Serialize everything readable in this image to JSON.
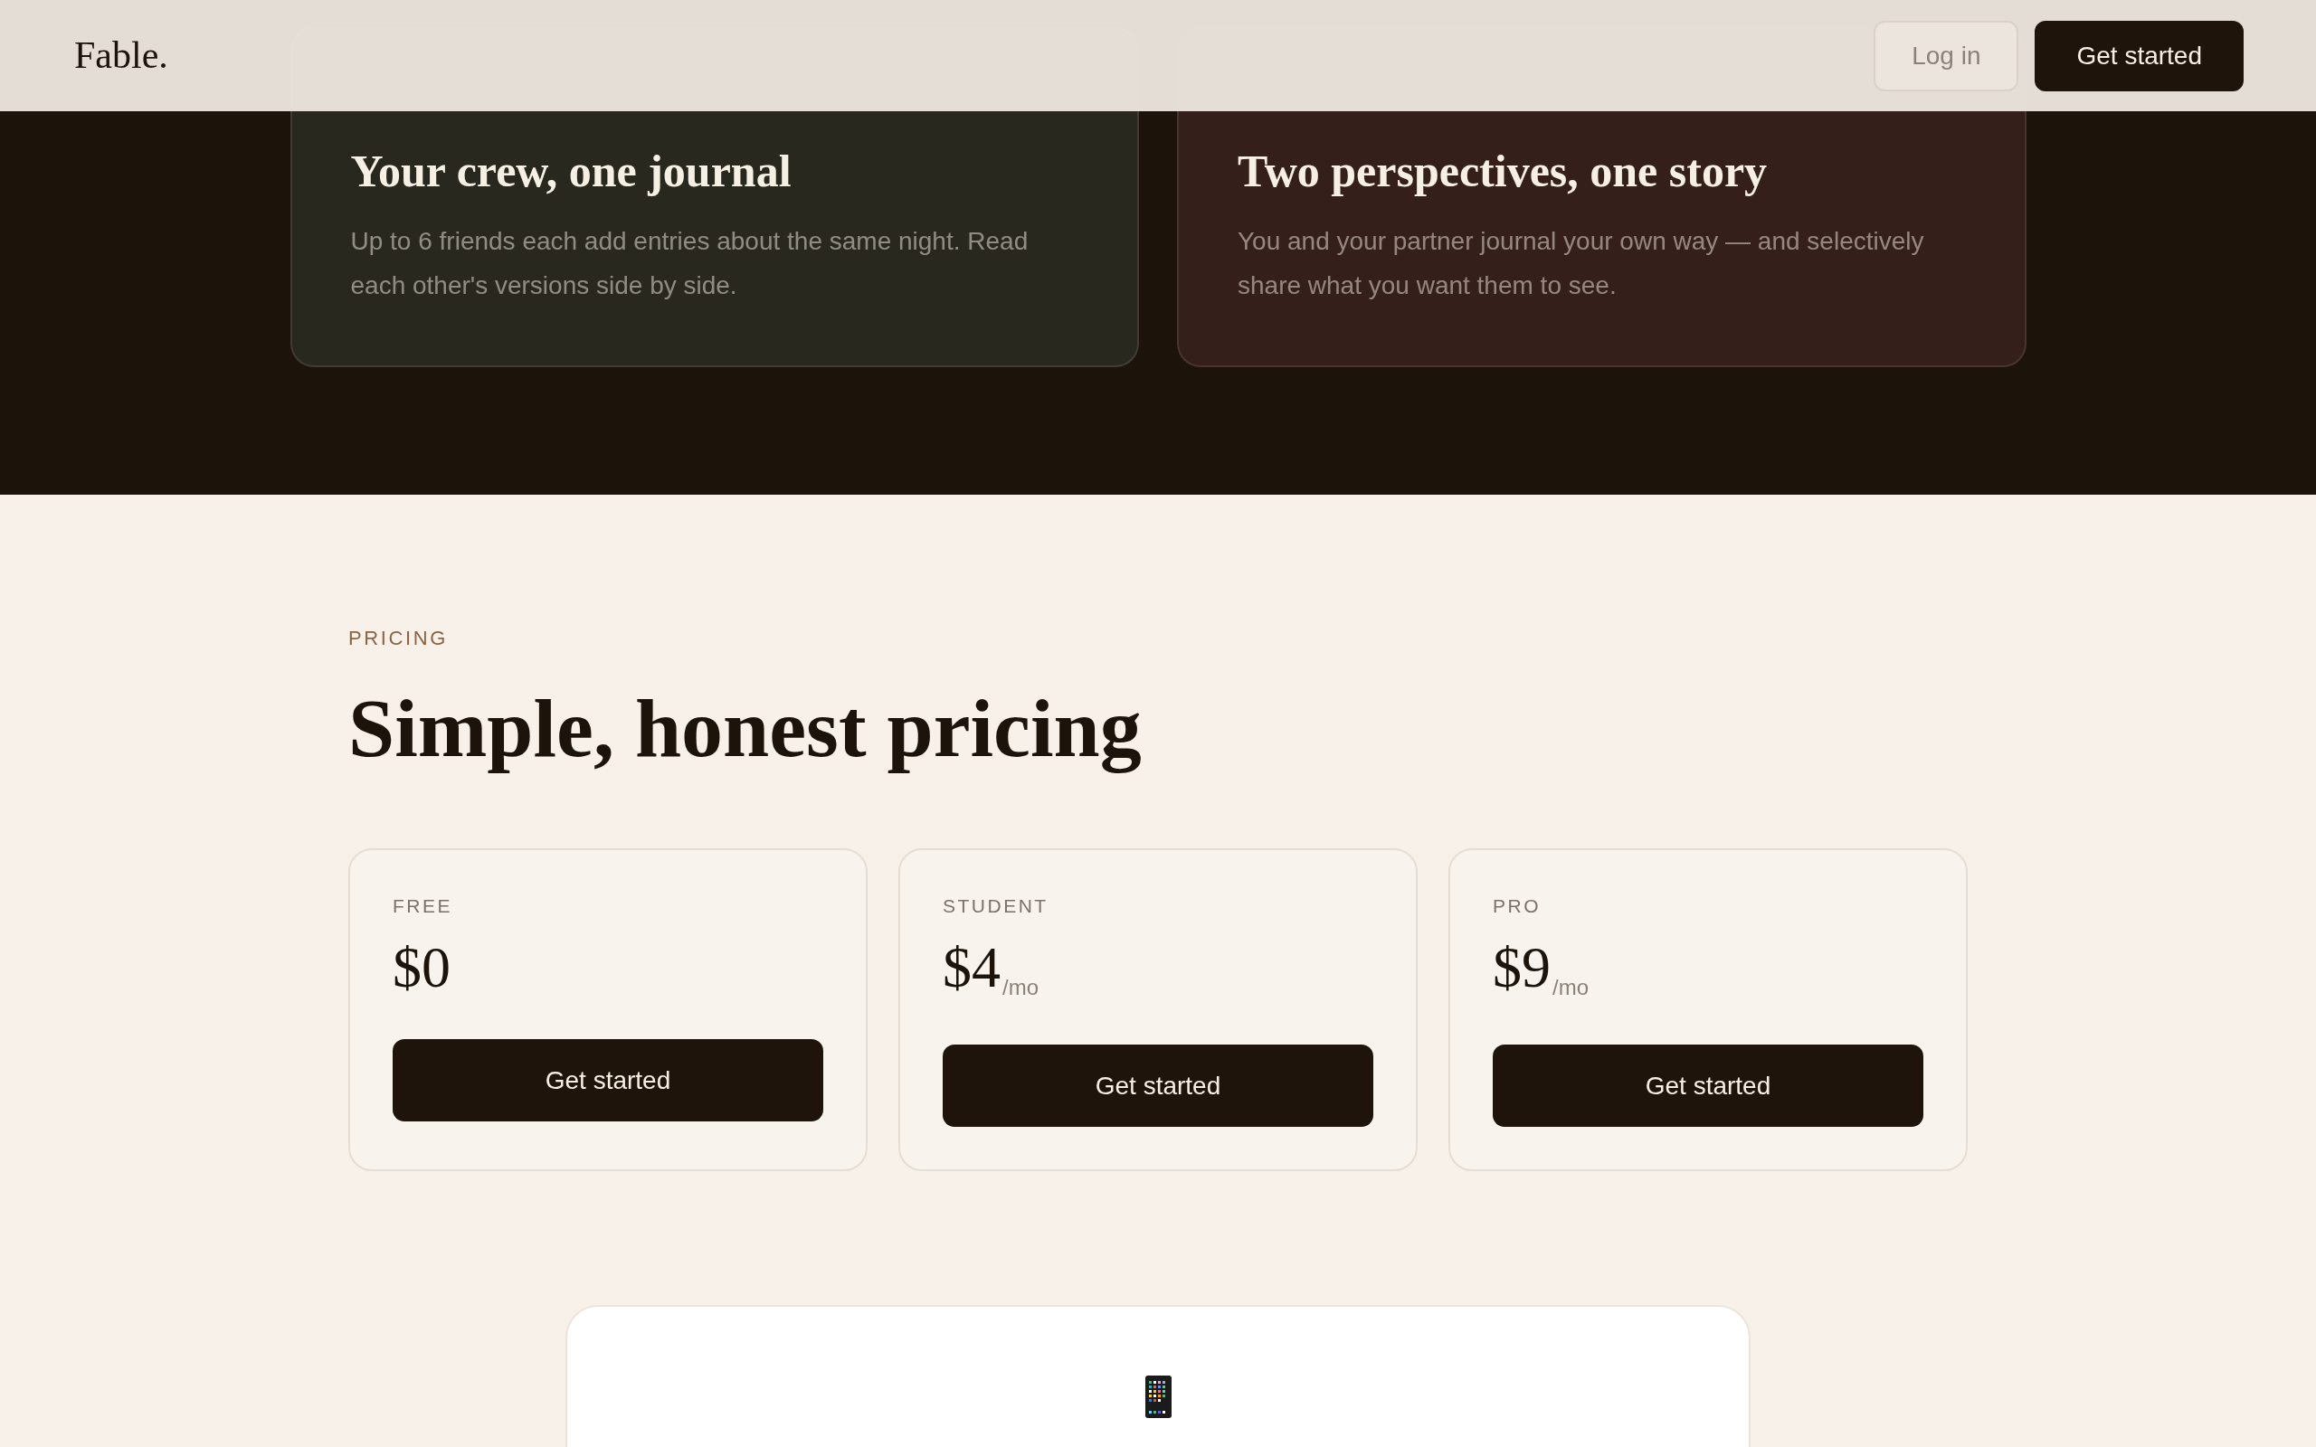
{
  "header": {
    "logo": "Fable.",
    "buttons": [
      {
        "label": "Log in",
        "kind": "secondary"
      },
      {
        "label": "Get started",
        "kind": "primary"
      }
    ]
  },
  "feature_cards": [
    {
      "title": "Your crew, one journal",
      "description": "Up to 6 friends each add entries about the same night. Read each other's versions side by side.",
      "color": "#29281f"
    },
    {
      "title": "Two perspectives, one story",
      "description": "You and your partner journal your own way — and selectively share what you want them to see.",
      "color": "#341f1b"
    }
  ],
  "pricing": {
    "eyebrow": "PRICING",
    "heading": "Simple, honest pricing",
    "plans": [
      {
        "name": "FREE",
        "price": "$0",
        "button": "Get started"
      },
      {
        "name": "STUDENT",
        "price": "$4",
        "period": "/mo",
        "button": "Get started"
      },
      {
        "name": "PRO",
        "price": "$9",
        "period": "/mo",
        "button": "Get started"
      }
    ]
  }
}
